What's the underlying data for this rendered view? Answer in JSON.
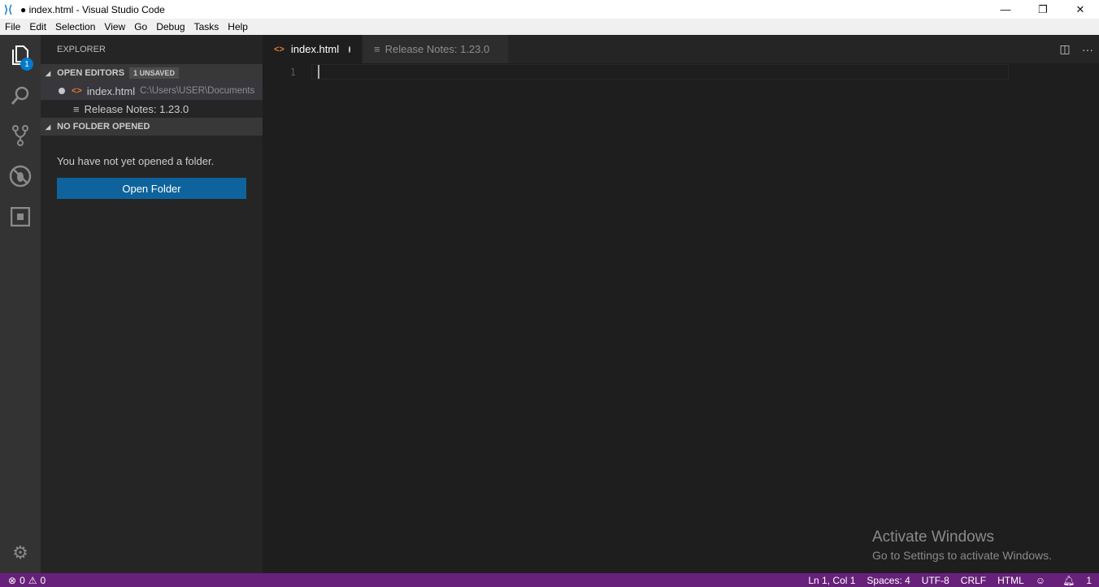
{
  "window": {
    "title": "● index.html - Visual Studio Code",
    "minimize": "—",
    "restore": "❐",
    "close": "✕"
  },
  "menu": [
    "File",
    "Edit",
    "Selection",
    "View",
    "Go",
    "Debug",
    "Tasks",
    "Help"
  ],
  "activity": {
    "explorer_badge": "1"
  },
  "sidebar": {
    "title": "EXPLORER",
    "open_editors": "OPEN EDITORS",
    "unsaved": "1 UNSAVED",
    "files": [
      {
        "name": "index.html",
        "path": "C:\\Users\\USER\\Documents"
      },
      {
        "name": "Release Notes: 1.23.0"
      }
    ],
    "no_folder": "NO FOLDER OPENED",
    "message": "You have not yet opened a folder.",
    "open_folder": "Open Folder"
  },
  "tabs": [
    {
      "label": "index.html"
    },
    {
      "label": "Release Notes: 1.23.0"
    }
  ],
  "editor": {
    "line": "1"
  },
  "watermark": {
    "title": "Activate Windows",
    "subtitle": "Go to Settings to activate Windows."
  },
  "status": {
    "errors": "0",
    "warnings": "0",
    "position": "Ln 1, Col 1",
    "spaces": "Spaces: 4",
    "encoding": "UTF-8",
    "eol": "CRLF",
    "language": "HTML",
    "notifications": "1"
  }
}
